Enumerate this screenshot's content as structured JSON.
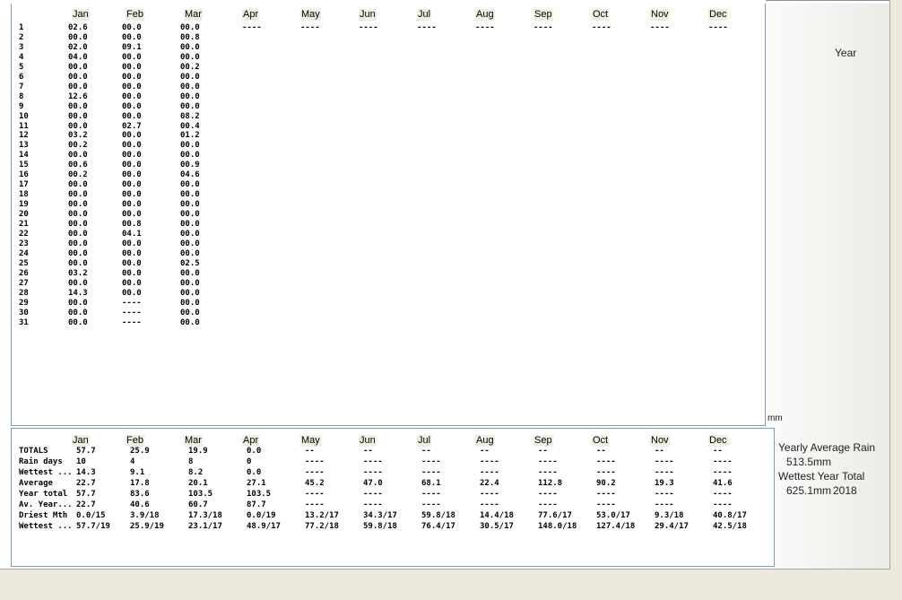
{
  "months": [
    "Jan",
    "Feb",
    "Mar",
    "Apr",
    "May",
    "Jun",
    "Jul",
    "Aug",
    "Sep",
    "Oct",
    "Nov",
    "Dec"
  ],
  "days": [
    "1",
    "2",
    "3",
    "4",
    "5",
    "6",
    "7",
    "8",
    "9",
    "10",
    "11",
    "12",
    "13",
    "14",
    "15",
    "16",
    "17",
    "18",
    "19",
    "20",
    "21",
    "22",
    "23",
    "24",
    "25",
    "26",
    "27",
    "28",
    "29",
    "30",
    "31"
  ],
  "daily": {
    "Jan": [
      "02.6",
      "00.0",
      "02.0",
      "04.0",
      "00.0",
      "00.0",
      "00.0",
      "12.6",
      "00.0",
      "00.0",
      "00.0",
      "03.2",
      "00.2",
      "00.0",
      "00.6",
      "00.2",
      "00.0",
      "00.0",
      "00.0",
      "00.0",
      "00.0",
      "00.0",
      "00.0",
      "00.0",
      "00.0",
      "03.2",
      "00.0",
      "14.3",
      "00.0",
      "00.0",
      "00.0"
    ],
    "Feb": [
      "00.0",
      "00.0",
      "09.1",
      "00.0",
      "00.0",
      "00.0",
      "00.0",
      "00.0",
      "00.0",
      "00.0",
      "02.7",
      "00.0",
      "00.0",
      "00.0",
      "00.0",
      "00.0",
      "00.0",
      "00.0",
      "00.0",
      "00.0",
      "00.8",
      "04.1",
      "00.0",
      "00.0",
      "00.0",
      "00.0",
      "00.0",
      "00.0",
      "----",
      "----",
      "----"
    ],
    "Mar": [
      "00.0",
      "00.8",
      "00.0",
      "00.0",
      "00.2",
      "00.0",
      "00.0",
      "00.0",
      "00.0",
      "08.2",
      "00.4",
      "01.2",
      "00.0",
      "00.0",
      "00.9",
      "04.6",
      "00.0",
      "00.0",
      "00.0",
      "00.0",
      "00.0",
      "00.0",
      "00.0",
      "00.0",
      "02.5",
      "00.0",
      "00.0",
      "00.0",
      "00.0",
      "00.0",
      "00.0"
    ]
  },
  "future_placeholder": "----",
  "future_months": [
    "Apr",
    "May",
    "Jun",
    "Jul",
    "Aug",
    "Sep",
    "Oct",
    "Nov",
    "Dec"
  ],
  "year_label": "Year",
  "mm_label": "mm",
  "summary_rows": [
    {
      "label": "TOTALS",
      "values": [
        "57.7",
        "25.9",
        "19.9",
        "0.0",
        "--",
        "--",
        "--",
        "--",
        "--",
        "--",
        "--",
        "--"
      ]
    },
    {
      "label": "Rain days",
      "values": [
        "10",
        "4",
        "8",
        "0",
        "----",
        "----",
        "----",
        "----",
        "----",
        "----",
        "----",
        "----"
      ]
    },
    {
      "label": "Wettest ...",
      "values": [
        "14.3",
        "9.1",
        "8.2",
        "0.0",
        "----",
        "----",
        "----",
        "----",
        "----",
        "----",
        "----",
        "----"
      ]
    },
    {
      "label": "Average",
      "values": [
        "22.7",
        "17.8",
        "20.1",
        "27.1",
        "45.2",
        "47.0",
        "68.1",
        "22.4",
        "112.8",
        "90.2",
        "19.3",
        "41.6"
      ]
    },
    {
      "label": "Year total",
      "values": [
        "57.7",
        "83.6",
        "103.5",
        "103.5",
        "----",
        "----",
        "----",
        "----",
        "----",
        "----",
        "----",
        "----"
      ]
    },
    {
      "label": "Av. Year...",
      "values": [
        "22.7",
        "40.6",
        "60.7",
        "87.7",
        "----",
        "----",
        "----",
        "----",
        "----",
        "----",
        "----",
        "----"
      ]
    },
    {
      "label": "Driest Mth",
      "values": [
        "0.0/15",
        "3.9/18",
        "17.3/18",
        "0.0/19",
        "13.2/17",
        "34.3/17",
        "59.8/18",
        "14.4/18",
        "77.6/17",
        "53.0/17",
        "9.3/18",
        "40.8/17"
      ]
    },
    {
      "label": "Wettest ...",
      "values": [
        "57.7/19",
        "25.9/19",
        "23.1/17",
        "48.9/17",
        "77.2/18",
        "59.8/18",
        "76.4/17",
        "30.5/17",
        "148.0/18",
        "127.4/18",
        "29.4/17",
        "42.5/18"
      ]
    }
  ],
  "side": {
    "yearly_average_label": "Yearly Average Rain",
    "yearly_average_value": "513.5mm",
    "wettest_year_label": "Wettest Year Total",
    "wettest_year_value": "625.1mm",
    "wettest_year": "2018"
  }
}
